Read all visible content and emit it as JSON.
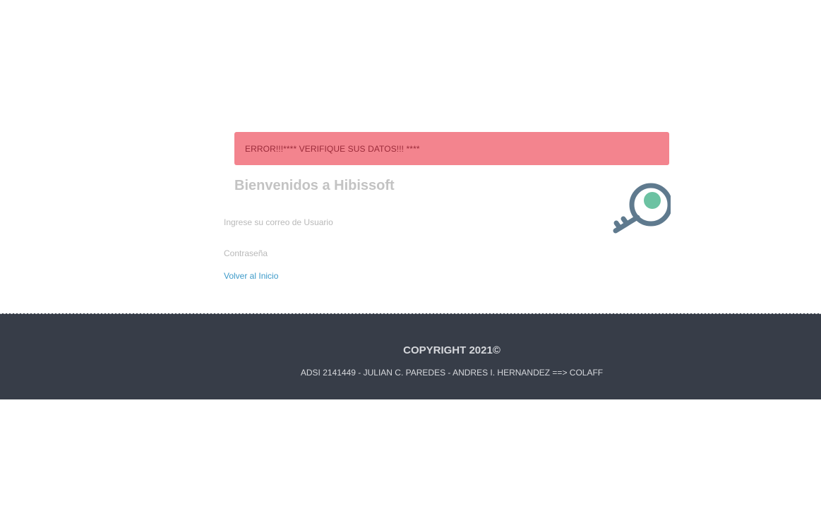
{
  "alert": {
    "message": "ERROR!!!**** VERIFIQUE SUS DATOS!!! ****"
  },
  "login": {
    "title": "Bienvenidos a Hibissoft",
    "email_label": "Ingrese su correo de Usuario",
    "password_label": "Contraseña",
    "back_link": "Volver al Inicio"
  },
  "footer": {
    "copyright": "COPYRIGHT 2021©",
    "credits": "ADSI 2141449 - JULIAN C. PAREDES - ANDRES I. HERNANDEZ ==> COLAFF"
  },
  "icons": {
    "key": "key-icon"
  },
  "colors": {
    "alert_bg": "#f3848e",
    "alert_text": "#9b2b3a",
    "link": "#3d9ac9",
    "footer_bg": "#373d48",
    "key_body": "#5f7a8e",
    "key_accent": "#6cc2a2"
  }
}
